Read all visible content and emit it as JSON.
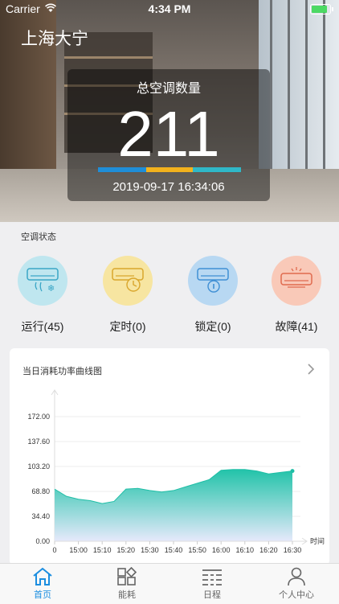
{
  "status_bar": {
    "carrier": "Carrier",
    "time": "4:34 PM"
  },
  "hero": {
    "city": "上海大宁",
    "total_label": "总空调数量",
    "total_count": "211",
    "datetime": "2019-09-17 16:34:06",
    "bar_colors": [
      "#1f8ed8",
      "#f2b21d",
      "#2fb8c8"
    ]
  },
  "status_section": {
    "title": "空调状态",
    "items": [
      {
        "label": "运行(45)",
        "icon": "ac-running-icon",
        "color": "#bfe6ef",
        "stroke": "#3aa6c6"
      },
      {
        "label": "定时(0)",
        "icon": "ac-timer-icon",
        "color": "#f7e5a1",
        "stroke": "#d9a62c"
      },
      {
        "label": "锁定(0)",
        "icon": "ac-locked-icon",
        "color": "#b8d8f2",
        "stroke": "#3f8fd4"
      },
      {
        "label": "故障(41)",
        "icon": "ac-fault-icon",
        "color": "#f9c9b8",
        "stroke": "#e06a4e"
      }
    ]
  },
  "chart_section": {
    "title": "当日消耗功率曲线图"
  },
  "chart_data": {
    "type": "area",
    "title": "当日消耗功率曲线图",
    "xlabel": "时间",
    "ylabel": "",
    "y_ticks": [
      "0.00",
      "34.40",
      "68.80",
      "103.20",
      "137.60",
      "172.00"
    ],
    "ylim": [
      0,
      206.4
    ],
    "x_ticks": [
      "0",
      "15:00",
      "15:10",
      "15:20",
      "15:30",
      "15:40",
      "15:50",
      "16:00",
      "16:10",
      "16:20",
      "16:30"
    ],
    "series": [
      {
        "x": [
          0,
          0.5,
          1,
          1.5,
          2,
          2.5,
          3,
          3.5,
          4,
          4.5,
          5,
          5.5,
          6,
          6.5,
          7,
          7.5,
          8,
          8.5,
          9,
          9.5,
          10
        ],
        "values": [
          72,
          62,
          58,
          56,
          52,
          55,
          72,
          73,
          70,
          68,
          70,
          75,
          80,
          85,
          98,
          99,
          99,
          97,
          93,
          95,
          97
        ]
      }
    ],
    "fill_top": "#22c3a9",
    "fill_bottom": "#e6e9fb",
    "grid": true
  },
  "tabbar": {
    "tabs": [
      {
        "label": "首页",
        "icon": "home-icon"
      },
      {
        "label": "能耗",
        "icon": "energy-grid-icon"
      },
      {
        "label": "日程",
        "icon": "schedule-icon"
      },
      {
        "label": "个人中心",
        "icon": "person-icon"
      }
    ]
  }
}
